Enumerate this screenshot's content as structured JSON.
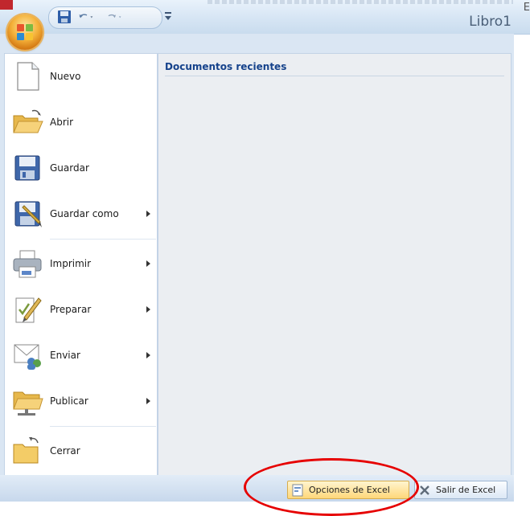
{
  "window": {
    "title": "Libro1",
    "edge_glyph": "E"
  },
  "quick_access": {
    "save_icon": "save-icon",
    "undo_icon": "undo-icon",
    "redo_icon": "redo-icon",
    "customize_icon": "customize-qat-icon"
  },
  "menu": {
    "items": [
      {
        "label": "Nuevo",
        "icon": "new-document-icon",
        "submenu": false
      },
      {
        "label": "Abrir",
        "icon": "open-folder-icon",
        "submenu": false
      },
      {
        "label": "Guardar",
        "icon": "save-icon",
        "submenu": false
      },
      {
        "label": "Guardar como",
        "icon": "save-as-icon",
        "submenu": true
      },
      {
        "label": "Imprimir",
        "icon": "printer-icon",
        "submenu": true
      },
      {
        "label": "Preparar",
        "icon": "prepare-icon",
        "submenu": true
      },
      {
        "label": "Enviar",
        "icon": "send-icon",
        "submenu": true
      },
      {
        "label": "Publicar",
        "icon": "publish-icon",
        "submenu": true
      },
      {
        "label": "Cerrar",
        "icon": "close-folder-icon",
        "submenu": false
      }
    ]
  },
  "recent": {
    "title": "Documentos recientes"
  },
  "footer": {
    "options_label": "Opciones de Excel",
    "exit_label": "Salir de Excel"
  },
  "colors": {
    "accent": "#15428b",
    "annotation": "#e60000",
    "office_orange": "#f4b13a"
  }
}
